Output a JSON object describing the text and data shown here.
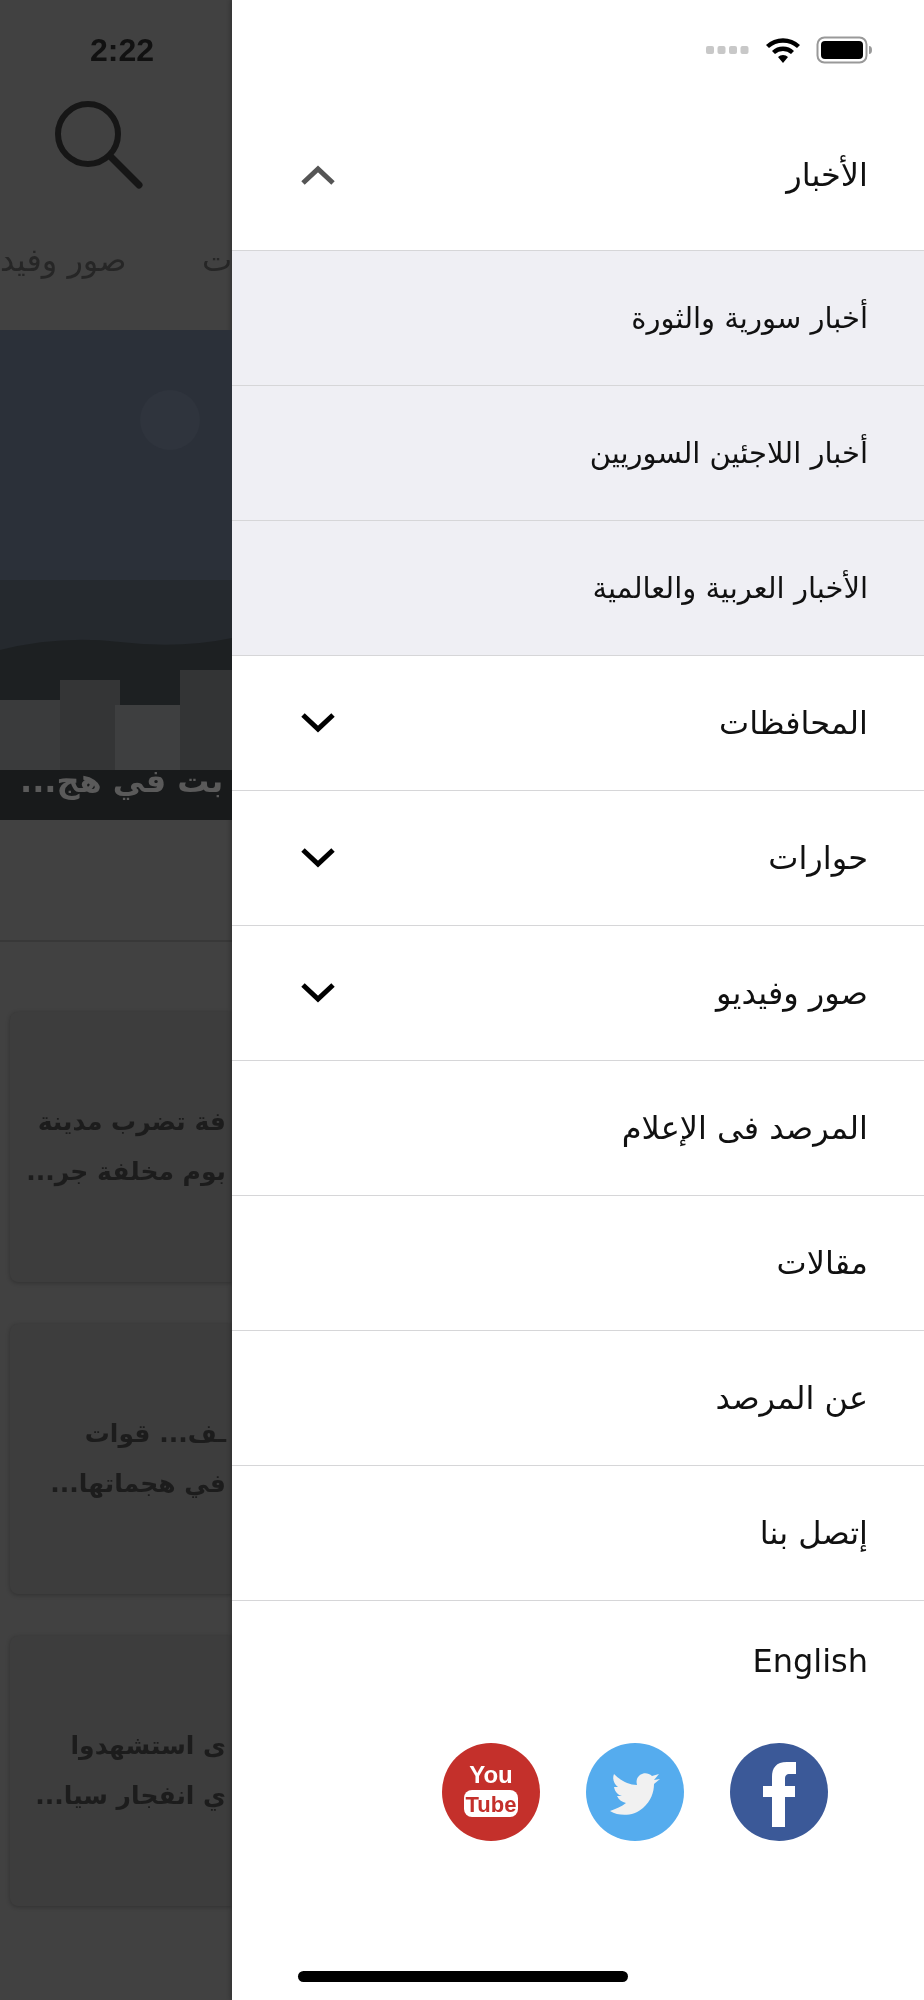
{
  "background": {
    "status_time": "2:22",
    "tabs": [
      "ت",
      "صور وفيد"
    ],
    "hero_caption": "بت في هج...",
    "cards": [
      {
        "text": "فة تضرب مدينة\nبوم مخلفة جر..."
      },
      {
        "text": "ـف... قوات\nفي هجماتها..."
      },
      {
        "text": "ى استشهدوا\nي انفجار سيا..."
      }
    ]
  },
  "menu": {
    "items": [
      {
        "label": "الأخبار",
        "expanded": true,
        "children": [
          {
            "label": "أخبار سورية والثورة"
          },
          {
            "label": "أخبار اللاجئين السوريين"
          },
          {
            "label": "الأخبار العربية والعالمية"
          }
        ]
      },
      {
        "label": "المحافظات",
        "expanded": false
      },
      {
        "label": "حوارات",
        "expanded": false
      },
      {
        "label": "صور وفيديو",
        "expanded": false
      },
      {
        "label": "المرصد فى الإعلام"
      },
      {
        "label": "مقالات"
      },
      {
        "label": "عن المرصد"
      },
      {
        "label": "إتصل بنا"
      },
      {
        "label": "English"
      }
    ],
    "social": [
      {
        "kind": "youtube",
        "lines": [
          "You",
          "Tube"
        ]
      },
      {
        "kind": "twitter"
      },
      {
        "kind": "facebook"
      }
    ]
  }
}
